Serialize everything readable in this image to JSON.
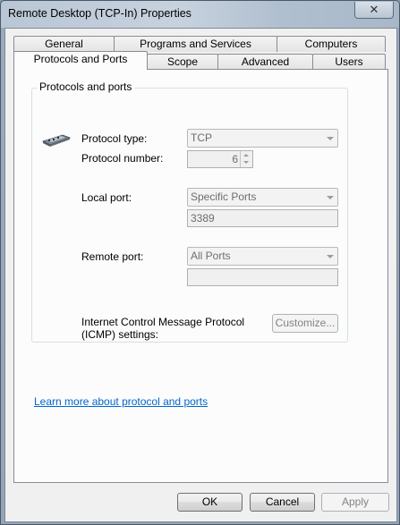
{
  "window": {
    "title": "Remote Desktop (TCP-In) Properties",
    "close_glyph": "✕"
  },
  "tabs": {
    "row1": [
      {
        "label": "General"
      },
      {
        "label": "Programs and Services"
      },
      {
        "label": "Computers"
      }
    ],
    "row2": [
      {
        "label": "Protocols and Ports",
        "active": true
      },
      {
        "label": "Scope"
      },
      {
        "label": "Advanced"
      },
      {
        "label": "Users"
      }
    ]
  },
  "group": {
    "legend": "Protocols and ports",
    "icon": "network-adapter-icon",
    "protocol_type_label": "Protocol type:",
    "protocol_type_value": "TCP",
    "protocol_number_label": "Protocol number:",
    "protocol_number_value": "6",
    "local_port_label": "Local port:",
    "local_port_value": "Specific Ports",
    "local_port_text": "3389",
    "remote_port_label": "Remote port:",
    "remote_port_value": "All Ports",
    "remote_port_text": "",
    "icmp_label_line1": "Internet Control Message Protocol",
    "icmp_label_line2": "(ICMP) settings:",
    "customize_label": "Customize..."
  },
  "learn_more_link": "Learn more about protocol and ports",
  "buttons": {
    "ok": "OK",
    "cancel": "Cancel",
    "apply": "Apply"
  },
  "colors": {
    "link": "#0066cc",
    "panel": "#fcfcfc",
    "dialog": "#f0f0f0"
  }
}
